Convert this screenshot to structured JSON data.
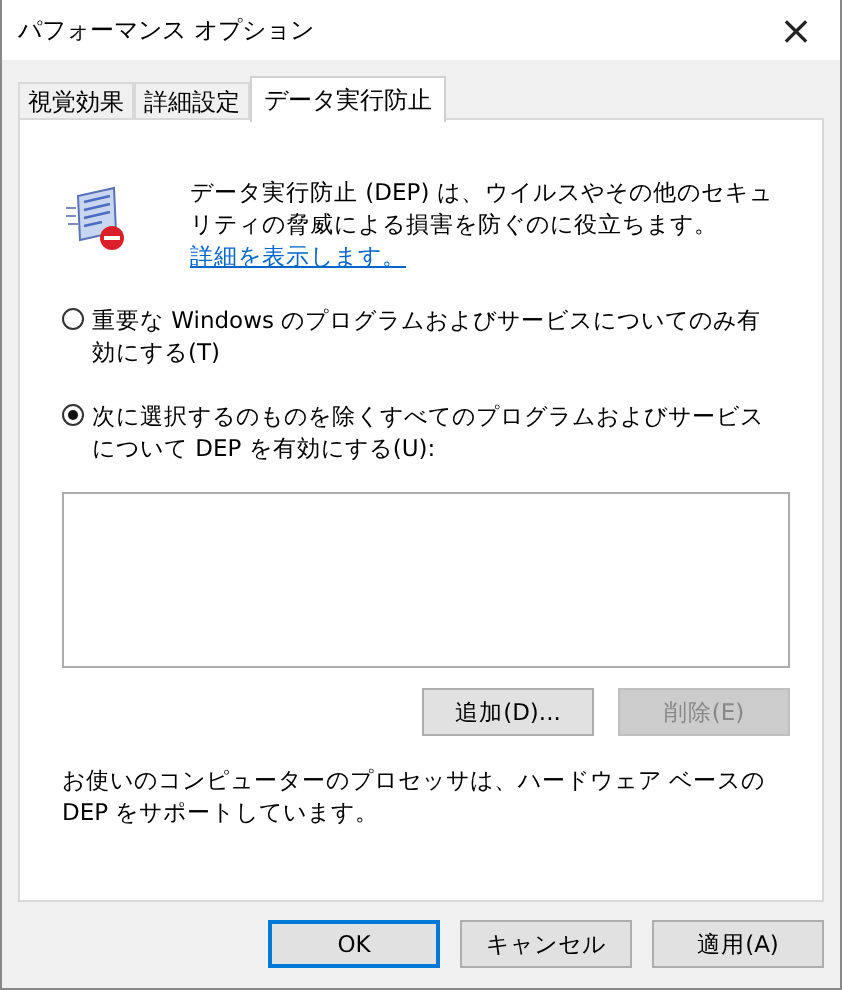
{
  "window": {
    "title": "パフォーマンス オプション",
    "close": "×"
  },
  "tabs": [
    {
      "label": "視覚効果",
      "selected": false
    },
    {
      "label": "詳細設定",
      "selected": false
    },
    {
      "label": "データ実行防止",
      "selected": true
    }
  ],
  "description": {
    "text": "データ実行防止 (DEP) は、ウイルスやその他のセキュリティの脅威による損害を防ぐのに役立ちます。",
    "link": "詳細を表示します。"
  },
  "options": [
    {
      "label": "重要な Windows のプログラムおよびサービスについてのみ有効にする(T)",
      "selected": false
    },
    {
      "label": "次に選択するのものを除くすべてのプログラムおよびサービスについて DEP を有効にする(U):",
      "selected": true
    }
  ],
  "list_buttons": [
    {
      "label": "追加(D)...",
      "disabled": false
    },
    {
      "label": "削除(E)",
      "disabled": true
    }
  ],
  "note": "お使いのコンピューターのプロセッサは、ハードウェア ベースの DEP をサポートしています。",
  "buttons": [
    {
      "label": "OK",
      "default": true
    },
    {
      "label": "キャンセル",
      "default": false
    },
    {
      "label": "適用(A)",
      "default": false
    }
  ]
}
